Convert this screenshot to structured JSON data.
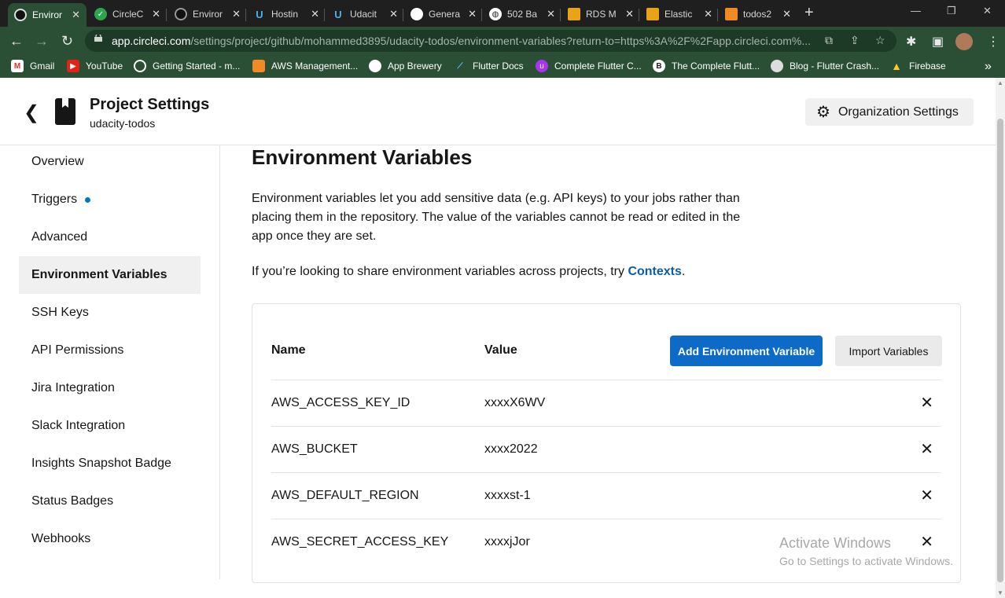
{
  "browser": {
    "tabs": [
      {
        "label": "Enviror",
        "icon": "circleci-icon",
        "active": true
      },
      {
        "label": "CircleC",
        "icon": "circleci-check-icon"
      },
      {
        "label": "Enviror",
        "icon": "circleci-icon"
      },
      {
        "label": "Hostin",
        "icon": "udacity-icon"
      },
      {
        "label": "Udacit",
        "icon": "udacity-icon"
      },
      {
        "label": "Genera",
        "icon": "github-icon"
      },
      {
        "label": "502 Ba",
        "icon": "globe-icon"
      },
      {
        "label": "RDS M",
        "icon": "aws-icon"
      },
      {
        "label": "Elastic",
        "icon": "aws-icon"
      },
      {
        "label": "todos2",
        "icon": "aws-orange-icon"
      }
    ],
    "url_domain": "app.circleci.com",
    "url_path": "/settings/project/github/mohammed3895/udacity-todos/environment-variables?return-to=https%3A%2F%2Fapp.circleci.com%...",
    "bookmarks": [
      {
        "label": "Gmail",
        "icon": "gmail-icon"
      },
      {
        "label": "YouTube",
        "icon": "youtube-icon"
      },
      {
        "label": "Getting Started - m...",
        "icon": "circle-icon"
      },
      {
        "label": "AWS Management...",
        "icon": "aws-icon"
      },
      {
        "label": "App Brewery",
        "icon": "github-icon"
      },
      {
        "label": "Flutter Docs",
        "icon": "flutter-icon"
      },
      {
        "label": "Complete Flutter C...",
        "icon": "udemy-icon"
      },
      {
        "label": "The Complete Flutt...",
        "icon": "b-icon"
      },
      {
        "label": "Blog - Flutter Crash...",
        "icon": "blog-icon"
      },
      {
        "label": "Firebase",
        "icon": "firebase-icon"
      }
    ],
    "more_bookmarks": "»"
  },
  "header": {
    "title": "Project Settings",
    "subtitle": "udacity-todos",
    "org_button": "Organization Settings"
  },
  "sidebar": {
    "items": [
      {
        "label": "Overview"
      },
      {
        "label": "Triggers",
        "dot": true
      },
      {
        "label": "Advanced"
      },
      {
        "label": "Environment Variables",
        "active": true
      },
      {
        "label": "SSH Keys"
      },
      {
        "label": "API Permissions"
      },
      {
        "label": "Jira Integration"
      },
      {
        "label": "Slack Integration"
      },
      {
        "label": "Insights Snapshot Badge"
      },
      {
        "label": "Status Badges"
      },
      {
        "label": "Webhooks"
      }
    ]
  },
  "main": {
    "title": "Environment Variables",
    "description": "Environment variables let you add sensitive data (e.g. API keys) to your jobs rather than placing them in the repository. The value of the variables cannot be read or edited in the app once they are set.",
    "share_text": "If you’re looking to share environment variables across projects, try ",
    "share_link": "Contexts",
    "share_end": ".",
    "table": {
      "col_name": "Name",
      "col_value": "Value",
      "add_button": "Add Environment Variable",
      "import_button": "Import Variables",
      "rows": [
        {
          "name": "AWS_ACCESS_KEY_ID",
          "value": "xxxxX6WV"
        },
        {
          "name": "AWS_BUCKET",
          "value": "xxxx2022"
        },
        {
          "name": "AWS_DEFAULT_REGION",
          "value": "xxxxst-1"
        },
        {
          "name": "AWS_SECRET_ACCESS_KEY",
          "value": "xxxxjJor"
        }
      ]
    }
  },
  "watermark": {
    "line1": "Activate Windows",
    "line2": "Go to Settings to activate Windows."
  },
  "colors": {
    "accent": "#0e6ac7",
    "browser_frame": "#2b4f35",
    "link": "#0a5ea8"
  }
}
